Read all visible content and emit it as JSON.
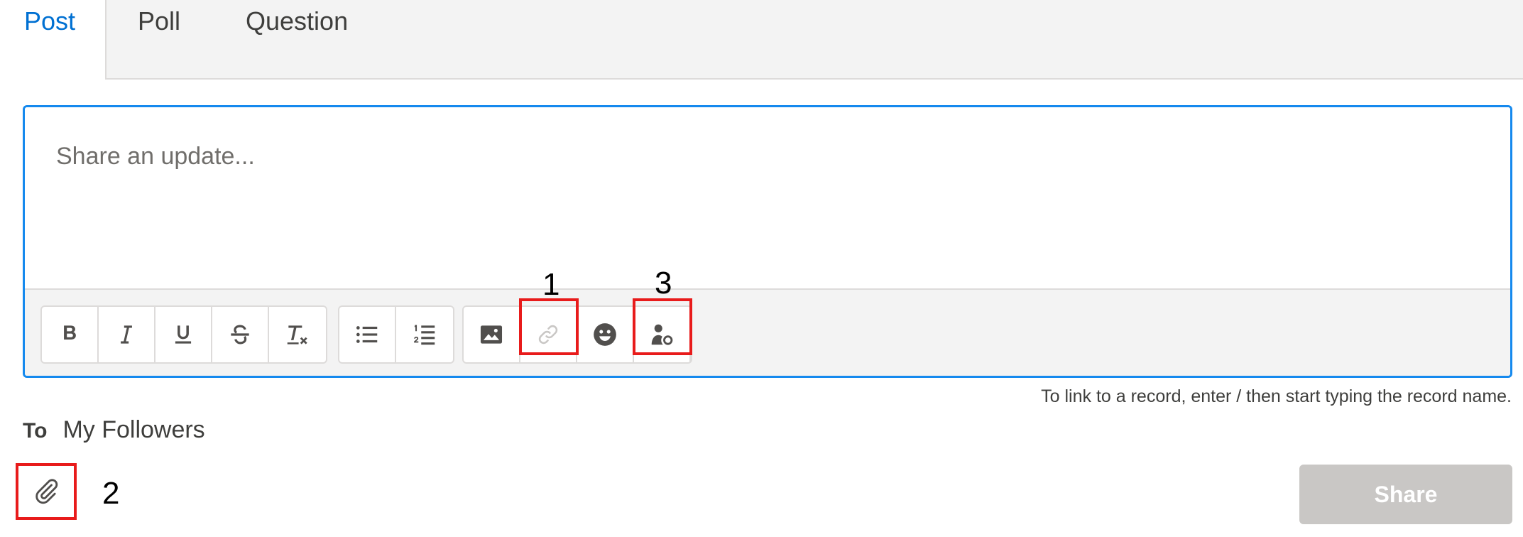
{
  "tabs": [
    {
      "label": "Post",
      "active": true
    },
    {
      "label": "Poll",
      "active": false
    },
    {
      "label": "Question",
      "active": false
    }
  ],
  "composer": {
    "placeholder": "Share an update...",
    "value": ""
  },
  "toolbar": {
    "groups": [
      [
        "bold-icon",
        "italic-icon",
        "underline-icon",
        "strikethrough-icon",
        "remove-formatting-icon"
      ],
      [
        "bulleted-list-icon",
        "numbered-list-icon"
      ],
      [
        "image-icon",
        "link-icon",
        "emoji-icon",
        "mention-icon"
      ]
    ]
  },
  "callouts": {
    "link": "1",
    "attach": "2",
    "mention": "3"
  },
  "hint": "To link to a record, enter / then start typing the record name.",
  "recipient": {
    "label": "To",
    "value": "My Followers"
  },
  "share_label": "Share",
  "colors": {
    "accent": "#0070d2",
    "focus_border": "#1589ee",
    "highlight": "#e81b1b",
    "disabled_button": "#c9c7c5"
  }
}
